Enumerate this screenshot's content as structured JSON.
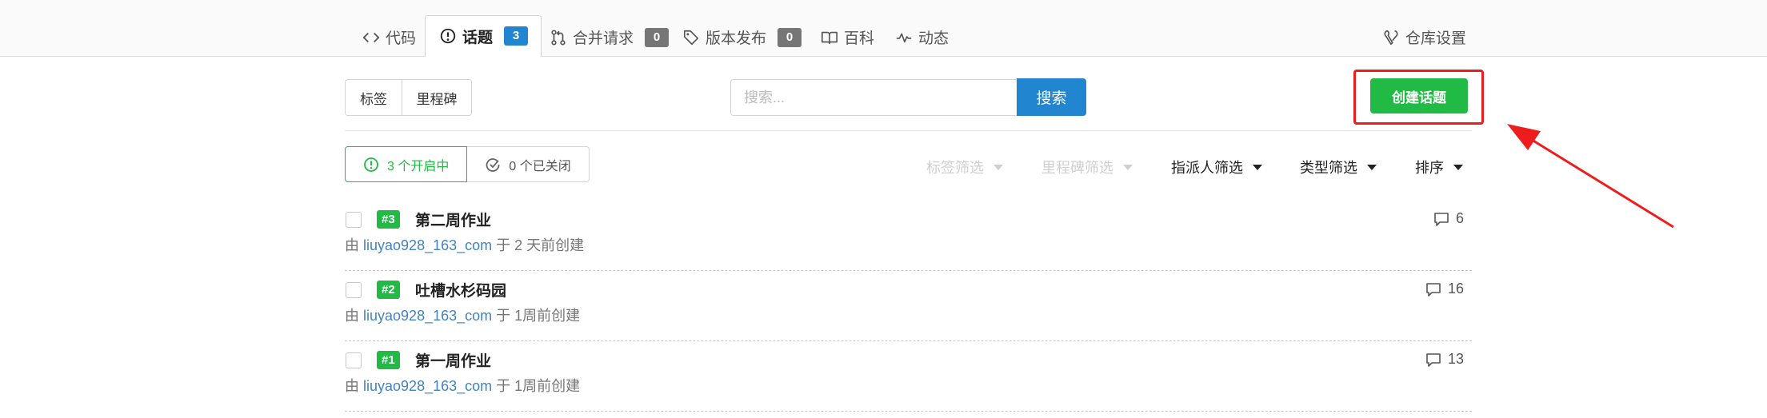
{
  "tabs": {
    "code": "代码",
    "issues": "话题",
    "issues_count": "3",
    "pulls": "合并请求",
    "pulls_count": "0",
    "releases": "版本发布",
    "releases_count": "0",
    "wiki": "百科",
    "activity": "动态",
    "settings": "仓库设置"
  },
  "toolbar": {
    "labels": "标签",
    "milestones": "里程碑",
    "search_placeholder": "搜索...",
    "search_button": "搜索",
    "create_button": "创建话题"
  },
  "state": {
    "open": "3 个开启中",
    "closed": "0 个已关闭"
  },
  "filters": {
    "label": "标签筛选",
    "milestone": "里程碑筛选",
    "assignee": "指派人筛选",
    "type": "类型筛选",
    "sort": "排序"
  },
  "issues": [
    {
      "number": "#3",
      "title": "第二周作业",
      "by": "由",
      "author": "liuyao928_163_com",
      "time": "于 2 天前创建",
      "comments": "6"
    },
    {
      "number": "#2",
      "title": "吐槽水杉码园",
      "by": "由",
      "author": "liuyao928_163_com",
      "time": "于 1周前创建",
      "comments": "16"
    },
    {
      "number": "#1",
      "title": "第一周作业",
      "by": "由",
      "author": "liuyao928_163_com",
      "time": "于 1周前创建",
      "comments": "13"
    }
  ],
  "colors": {
    "primary": "#2185d0",
    "success": "#21ba45",
    "annotation": "#ee1d1d"
  },
  "icons": [
    "code-icon",
    "issue-icon",
    "pull-request-icon",
    "tag-icon",
    "book-icon",
    "pulse-icon",
    "tools-icon",
    "comment-icon"
  ]
}
